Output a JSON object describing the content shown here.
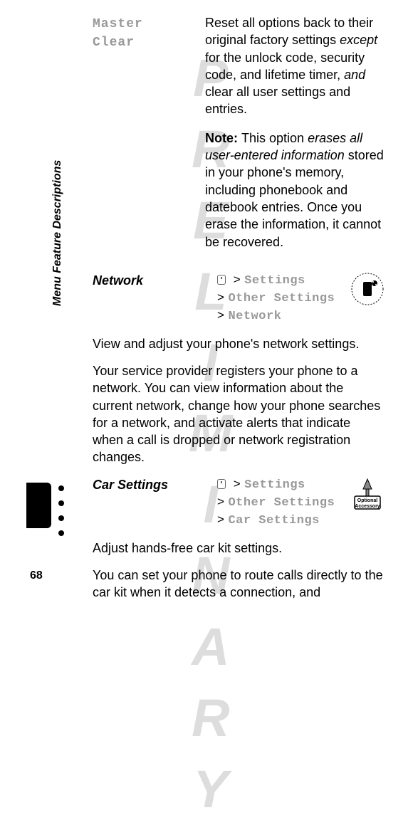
{
  "watermark": "PRELIMINARY",
  "sidebar_label": "Menu Feature Descriptions",
  "page_number": "68",
  "master_clear": {
    "label": "Master Clear",
    "desc_1_a": "Reset all options back to their original factory settings ",
    "desc_1_except": "except",
    "desc_1_b": " for the unlock code, security code, and lifetime timer, ",
    "desc_1_and": "and",
    "desc_1_c": " clear all user settings and entries.",
    "note_label": "Note: ",
    "note_a": "This option ",
    "note_em": "erases all user-entered information",
    "note_b": " stored in your phone's memory, including phonebook and datebook entries. Once you erase the information, it cannot be recovered."
  },
  "network": {
    "title": "Network",
    "bc_gt": ">",
    "bc1": "Settings",
    "bc2": "Other Settings",
    "bc3": "Network",
    "para1": "View and adjust your phone's network settings.",
    "para2": "Your service provider registers your phone to a network. You can view information about the current network, change how your phone searches for a network, and activate alerts that indicate when a call is dropped or network registration changes."
  },
  "car": {
    "title": "Car Settings",
    "bc_gt": ">",
    "bc1": "Settings",
    "bc2": "Other Settings",
    "bc3": "Car Settings",
    "badge_top": "Optional",
    "badge_bottom": "Accessory",
    "para1": "Adjust hands-free car kit settings.",
    "para2": "You can set your phone to route calls directly to the car kit when it detects a connection, and"
  }
}
